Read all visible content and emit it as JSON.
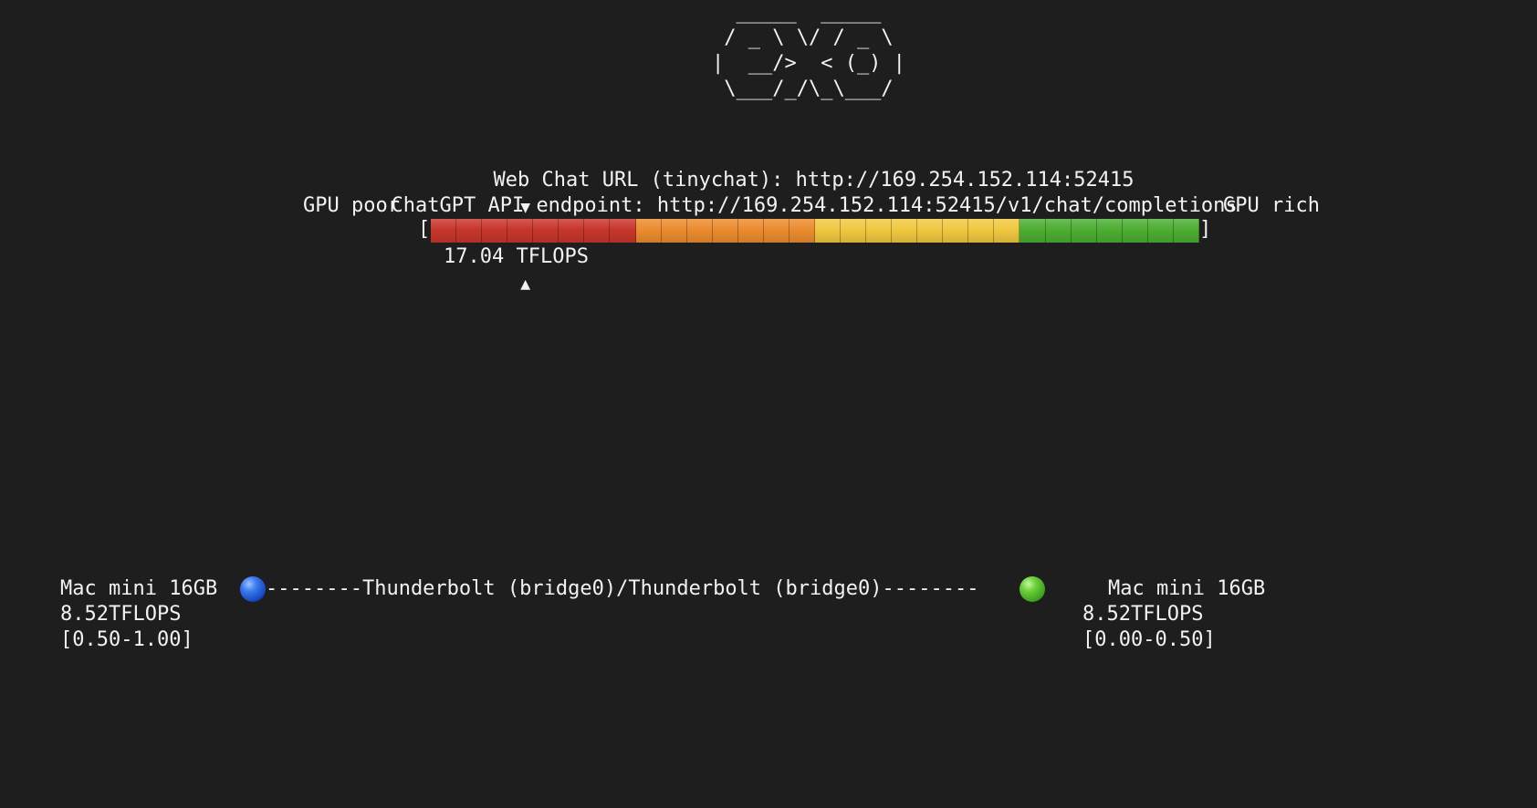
{
  "logo": {
    "ascii": "  _____  _____\n / _ \\ \\/ / _ \\\n|  __/>  < (_) |\n \\___/_/\\_\\___/"
  },
  "header": {
    "web_chat_label": "Web Chat URL (tinychat):",
    "web_chat_url": "http://169.254.152.114:52415",
    "api_label": "ChatGPT API endpoint:",
    "api_url": "http://169.254.152.114:52415/v1/chat/completions"
  },
  "gauge": {
    "left_label": "GPU poor",
    "right_label": "GPU rich",
    "left_bracket": "[",
    "right_bracket": "]",
    "marker_down": "▼",
    "marker_up": "▲",
    "value_text": "17.04 TFLOPS",
    "position_fraction": 0.125,
    "segments": [
      {
        "color": "#c8362c",
        "count": 8
      },
      {
        "color": "#ec8c2f",
        "count": 7
      },
      {
        "color": "#f0c840",
        "count": 8
      },
      {
        "color": "#4cae32",
        "count": 7
      }
    ]
  },
  "topology": {
    "left_node": {
      "name": "Mac mini 16GB",
      "tflops": "8.52TFLOPS",
      "range": "[0.50-1.00]",
      "dot_color": "#2f6ee0"
    },
    "link": "--------Thunderbolt (bridge0)/Thunderbolt (bridge0)--------",
    "right_node": {
      "name": "Mac mini 16GB",
      "tflops": "8.52TFLOPS",
      "range": "[0.00-0.50]",
      "dot_color": "#4cbf2a"
    }
  }
}
